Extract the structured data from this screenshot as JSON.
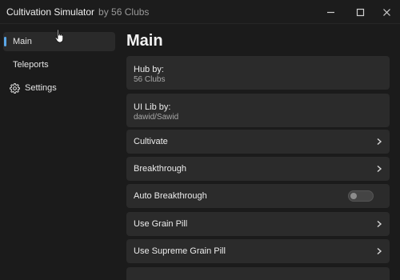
{
  "window": {
    "title": "Cultivation Simulator",
    "subtitle": "by 56 Clubs",
    "controls": [
      "minimize",
      "maximize",
      "close"
    ]
  },
  "sidebar": {
    "items": [
      {
        "label": "Main",
        "active": true
      },
      {
        "label": "Teleports",
        "active": false
      },
      {
        "label": "Settings",
        "active": false,
        "icon": "gear-icon"
      }
    ]
  },
  "main": {
    "title": "Main",
    "info_cards": [
      {
        "title": "Hub by:",
        "value": "56 Clubs"
      },
      {
        "title": "UI Lib by:",
        "value": "dawid/Sawid"
      }
    ],
    "rows": [
      {
        "label": "Cultivate",
        "type": "button"
      },
      {
        "label": "Breakthrough",
        "type": "button"
      },
      {
        "label": "Auto Breakthrough",
        "type": "toggle",
        "state": "off"
      },
      {
        "label": "Use Grain Pill",
        "type": "button"
      },
      {
        "label": "Use Supreme Grain Pill",
        "type": "button"
      }
    ]
  },
  "colors": {
    "accent": "#5aa7e8",
    "background": "#1b1b1b",
    "card": "#2b2b2b"
  }
}
